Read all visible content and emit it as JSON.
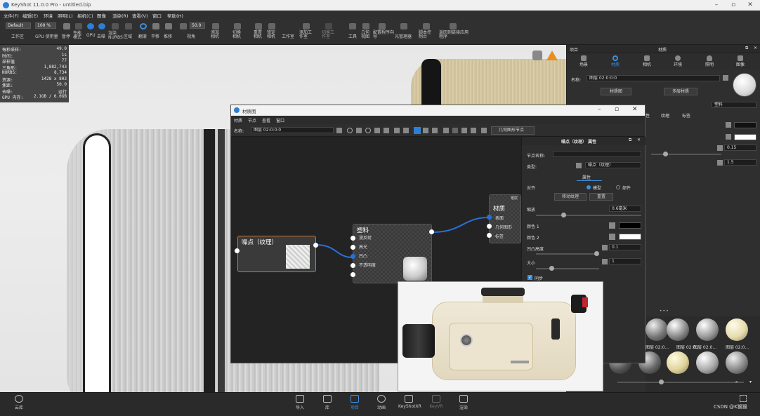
{
  "window": {
    "title": "KeyShot 11.0.0 Pro  - untitled.bip"
  },
  "menu": [
    "文件(F)",
    "编辑(E)",
    "环境",
    "照明(L)",
    "相机(C)",
    "图像",
    "渲染(R)",
    "查看(V)",
    "窗口",
    "帮助(H)"
  ],
  "toolbar": {
    "workspace_value": "Default",
    "workspace_label": "工作区",
    "cpu_value": "100 %",
    "cpu_label": "GPU 使用量",
    "pause_label": "暂停",
    "perf_label": "性能模式",
    "gpu_label": "GPU",
    "denoise_label": "去噪",
    "nurbs_label": "渲染NURBS",
    "region_label": "区域",
    "tumble_label": "翻滚",
    "pan_label": "平移",
    "dolly_label": "推移",
    "fov_value": "50.0",
    "fov_label": "视角",
    "add_camera_label": "添加相机",
    "switch_camera_label": "切换相机",
    "reset_camera_label": "重置相机",
    "lock_camera_label": "锁定相机",
    "studio_label": "工作室",
    "add_studio_label": "添加工作室",
    "switch_studio_label": "切换工作室",
    "tools_label": "工具",
    "geometry_label": "几何视图",
    "config_label": "配置程序向导",
    "light_manager_label": "光管理器",
    "script_label": "脚本控制台",
    "link_label": "返回到链接应用程序"
  },
  "stats": [
    {
      "k": "每秒采样:",
      "v": "49.0"
    },
    {
      "k": "时间:",
      "v": "1s"
    },
    {
      "k": "采样值",
      "v": "77"
    },
    {
      "k": "三角形:",
      "v": "1,882,743"
    },
    {
      "k": "NURBS:",
      "v": "8,734"
    },
    {
      "k": "资源:",
      "v": "1428 x 803"
    },
    {
      "k": "焦距:",
      "v": "50.0"
    },
    {
      "k": "去噪:",
      "v": "运行"
    },
    {
      "k": "GPU 内存:",
      "v": "2.1GB / 6.0GB"
    }
  ],
  "right_panel": {
    "header_left": "项目",
    "header_center": "材质",
    "tabs": [
      "场景",
      "材质",
      "相机",
      "环境",
      "照明",
      "图像"
    ],
    "name_label": "名称:",
    "name_value": "图层 02:0:0:0",
    "graph_button": "材质图",
    "multi_button": "多层材质",
    "type_value": "塑料",
    "sub_tabs": [
      "性",
      "纹理",
      "标签"
    ],
    "values": [
      "0.15",
      "1.5"
    ],
    "library_items": [
      "图层 02:0...",
      "图层 02:0...",
      "图层 02:0...",
      "图层 02:0..."
    ]
  },
  "material_graph": {
    "title": "材质图",
    "menu": [
      "材质",
      "节点",
      "查看",
      "窗口"
    ],
    "name_label": "名称:",
    "name_value": "图层 02:0:0:0",
    "geometry_node_button": "几何图形节点",
    "noise_node": {
      "title": "噪点（纹理）",
      "port": ""
    },
    "plastic_node": {
      "title": "塑料",
      "ports": [
        "漫反射",
        "高光",
        "凹凸",
        "不透明度",
        ""
      ]
    },
    "material_node": {
      "badge": "根层",
      "title": "材质",
      "ports": [
        "表面",
        "几何图形",
        "标签"
      ]
    },
    "props": {
      "header": "噪点（纹理）  属性",
      "node_name_label": "节点名称:",
      "type_label": "类型:",
      "type_value": "噪点（纹理）",
      "attr_tab": "属性",
      "map_label": "对齐",
      "map_opt1": "模型",
      "map_opt2": "部件",
      "move_button": "移动纹理",
      "reset_button": "重置",
      "scale_label": "缩放",
      "scale_value": "0.6毫米",
      "color1_label": "颜色 1",
      "color2_label": "颜色 2",
      "bump_label": "凹凸高度",
      "bump_value": "0.1",
      "size_label": "大小",
      "size_value": "1",
      "sync_label": "同步"
    }
  },
  "bottom_bar": {
    "left_label": "云库",
    "items": [
      "导入",
      "库",
      "项目",
      "动画",
      "KeyShotXR",
      "KeyVR",
      "渲染"
    ],
    "watermark": "CSDN @K猴猴"
  },
  "colors": {
    "accent": "#2d7fd3",
    "node_border": "#c9772e",
    "link": "#2a6fd6"
  }
}
